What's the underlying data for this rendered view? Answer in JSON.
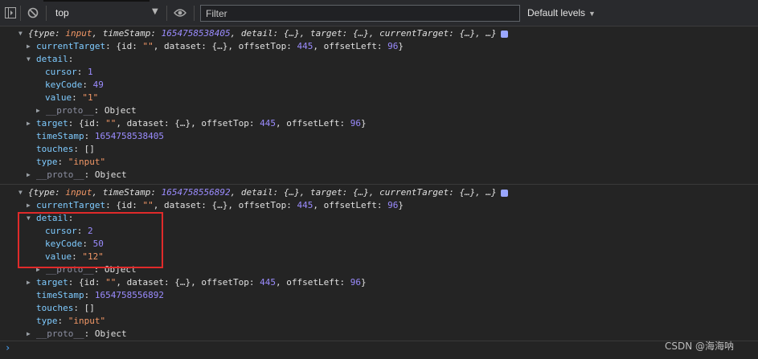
{
  "toolbar": {
    "context": "top",
    "filter_placeholder": "Filter",
    "levels_label": "Default levels"
  },
  "entries": [
    {
      "summary": {
        "type": "input",
        "timeStamp": "1654758538405"
      },
      "currentTarget": {
        "id": "\"\"",
        "offsetTop": "445",
        "offsetLeft": "96"
      },
      "detail": {
        "cursor": "1",
        "keyCode": "49",
        "value": "\"1\""
      },
      "target": {
        "id": "\"\"",
        "offsetTop": "445",
        "offsetLeft": "96"
      },
      "timeStamp": "1654758538405",
      "touches": "[]",
      "type": "\"input\""
    },
    {
      "summary": {
        "type": "input",
        "timeStamp": "1654758556892"
      },
      "currentTarget": {
        "id": "\"\"",
        "offsetTop": "445",
        "offsetLeft": "96"
      },
      "detail": {
        "cursor": "2",
        "keyCode": "50",
        "value": "\"12\""
      },
      "target": {
        "id": "\"\"",
        "offsetTop": "445",
        "offsetLeft": "96"
      },
      "timeStamp": "1654758556892",
      "touches": "[]",
      "type": "\"input\""
    }
  ],
  "watermark": "CSDN @海海呐"
}
